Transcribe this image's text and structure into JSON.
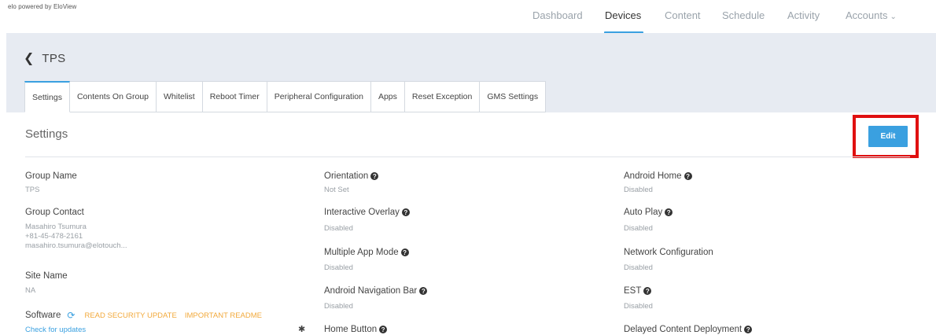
{
  "brand": "elo powered by EloView",
  "nav": {
    "items": [
      {
        "label": "Dashboard"
      },
      {
        "label": "Devices"
      },
      {
        "label": "Content"
      },
      {
        "label": "Schedule"
      },
      {
        "label": "Activity"
      },
      {
        "label": "Accounts"
      }
    ],
    "active": "Devices"
  },
  "header": {
    "back_icon": "chevron-left-icon",
    "title": "TPS"
  },
  "tabs": [
    {
      "label": "Settings"
    },
    {
      "label": "Contents On Group"
    },
    {
      "label": "Whitelist"
    },
    {
      "label": "Reboot Timer"
    },
    {
      "label": "Peripheral Configuration"
    },
    {
      "label": "Apps"
    },
    {
      "label": "Reset Exception"
    },
    {
      "label": "GMS Settings"
    }
  ],
  "settings": {
    "title": "Settings",
    "edit_label": "Edit",
    "group_name": {
      "label": "Group Name",
      "value": "TPS"
    },
    "group_contact": {
      "label": "Group Contact",
      "name": "Masahiro Tsumura",
      "phone": "+81-45-478-2161",
      "email": "masahiro.tsumura@elotouch..."
    },
    "site_name": {
      "label": "Site Name",
      "value": "NA"
    },
    "software": {
      "label": "Software",
      "security_link": "READ SECURITY UPDATE",
      "readme_link": "IMPORTANT README",
      "check_link": "Check for updates"
    },
    "orientation": {
      "label": "Orientation",
      "value": "Not Set"
    },
    "interactive_overlay": {
      "label": "Interactive Overlay",
      "value": "Disabled"
    },
    "multiple_app_mode": {
      "label": "Multiple App Mode",
      "value": "Disabled"
    },
    "android_nav_bar": {
      "label": "Android Navigation Bar",
      "value": "Disabled"
    },
    "home_button": {
      "label": "Home Button"
    },
    "android_home": {
      "label": "Android Home",
      "value": "Disabled"
    },
    "auto_play": {
      "label": "Auto Play",
      "value": "Disabled"
    },
    "network_config": {
      "label": "Network Configuration",
      "value": "Disabled"
    },
    "est": {
      "label": "EST",
      "value": "Disabled"
    },
    "delayed_content": {
      "label": "Delayed Content Deployment"
    }
  },
  "colors": {
    "accent": "#3aa0e0",
    "highlight": "#e01010",
    "link_orange": "#f2a93b",
    "band": "#e7ebf2"
  }
}
